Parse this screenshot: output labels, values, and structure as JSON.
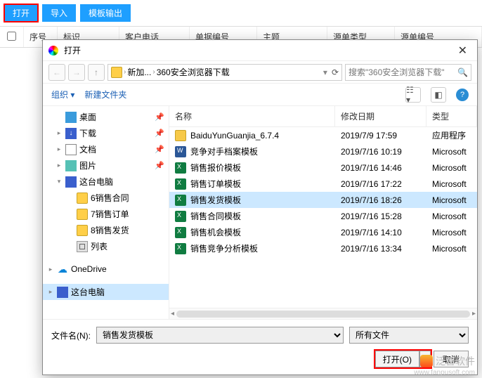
{
  "toolbar": {
    "open": "打开",
    "import": "导入",
    "template_out": "模板输出"
  },
  "grid": {
    "seq": "序号",
    "flag": "标识",
    "cust_phone": "客户电话",
    "doc_no": "单据编号",
    "subject": "主题",
    "src_type": "源单类型",
    "src_no": "源单编号"
  },
  "dialog": {
    "title": "打开",
    "crumbs": [
      "新加...",
      "360安全浏览器下载"
    ],
    "search_placeholder": "搜索\"360安全浏览器下载\"",
    "organize": "组织",
    "new_folder": "新建文件夹",
    "filehead": {
      "name": "名称",
      "date": "修改日期",
      "type": "类型"
    },
    "filename_label": "文件名(N):",
    "filename_value": "销售发货模板",
    "filetype_value": "所有文件",
    "open_btn": "打开(O)",
    "cancel_btn": "取消"
  },
  "sidebar": [
    {
      "label": "桌面",
      "icon": "desktop",
      "indent": 1,
      "pin": true
    },
    {
      "label": "下载",
      "icon": "download",
      "indent": 1,
      "disclosure": "▸",
      "pin": true
    },
    {
      "label": "文档",
      "icon": "doc",
      "indent": 1,
      "disclosure": "▸",
      "pin": true
    },
    {
      "label": "图片",
      "icon": "pic",
      "indent": 1,
      "disclosure": "▸",
      "pin": true
    },
    {
      "label": "这台电脑",
      "icon": "pc",
      "indent": 1,
      "disclosure": "▾"
    },
    {
      "label": "6销售合同",
      "icon": "folder",
      "indent": 2
    },
    {
      "label": "7销售订单",
      "icon": "folder",
      "indent": 2
    },
    {
      "label": "8销售发货",
      "icon": "folder",
      "indent": 2
    },
    {
      "label": "列表",
      "icon": "table",
      "indent": 2
    },
    {
      "label": "",
      "icon": "",
      "indent": 0,
      "blank": true
    },
    {
      "label": "OneDrive",
      "icon": "onedrive",
      "indent": 0,
      "disclosure": "▸"
    },
    {
      "label": "",
      "icon": "",
      "indent": 0,
      "blank": true
    },
    {
      "label": "这台电脑",
      "icon": "pc",
      "indent": 0,
      "disclosure": "▸",
      "selected": true
    },
    {
      "label": "",
      "icon": "",
      "indent": 0,
      "blank": true
    }
  ],
  "files": [
    {
      "name": "BaiduYunGuanjia_6.7.4",
      "date": "2019/7/9 17:59",
      "type": "应用程序",
      "ico": "exe"
    },
    {
      "name": "竞争对手档案模板",
      "date": "2019/7/16 10:19",
      "type": "Microsoft",
      "ico": "doc"
    },
    {
      "name": "销售报价模板",
      "date": "2019/7/16 14:46",
      "type": "Microsoft",
      "ico": "xls"
    },
    {
      "name": "销售订单模板",
      "date": "2019/7/16 17:22",
      "type": "Microsoft",
      "ico": "xls"
    },
    {
      "name": "销售发货模板",
      "date": "2019/7/16 18:26",
      "type": "Microsoft",
      "ico": "xls",
      "selected": true
    },
    {
      "name": "销售合同模板",
      "date": "2019/7/16 15:28",
      "type": "Microsoft",
      "ico": "xls"
    },
    {
      "name": "销售机会模板",
      "date": "2019/7/16 14:10",
      "type": "Microsoft",
      "ico": "xls"
    },
    {
      "name": "销售竞争分析模板",
      "date": "2019/7/16 13:34",
      "type": "Microsoft",
      "ico": "xls"
    }
  ],
  "watermark": {
    "text": "泛普软件",
    "url": "www.fanpusoft.com"
  }
}
